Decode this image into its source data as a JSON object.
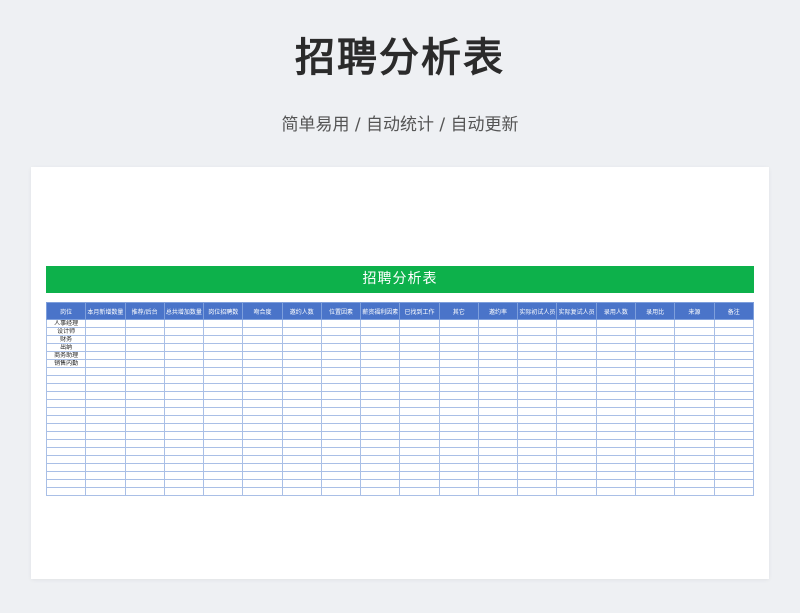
{
  "title": "招聘分析表",
  "subtitle": "简单易用 / 自动统计 / 自动更新",
  "sheet": {
    "banner": "招聘分析表",
    "columns": [
      "岗位",
      "本月新增数量",
      "推荐/后台",
      "总共增加数量",
      "岗位招聘数",
      "吻合度",
      "邀约人数",
      "位置因素",
      "薪资福利因素",
      "已找到工作",
      "其它",
      "邀约率",
      "实际初试人员",
      "实际复试人员",
      "录用人数",
      "录用比",
      "来源",
      "备注"
    ],
    "rows": [
      "人事经理",
      "设计师",
      "财务",
      "出纳",
      "商务助理",
      "销售内勤",
      "",
      "",
      "",
      "",
      "",
      "",
      "",
      "",
      "",
      "",
      "",
      "",
      "",
      "",
      "",
      ""
    ]
  }
}
